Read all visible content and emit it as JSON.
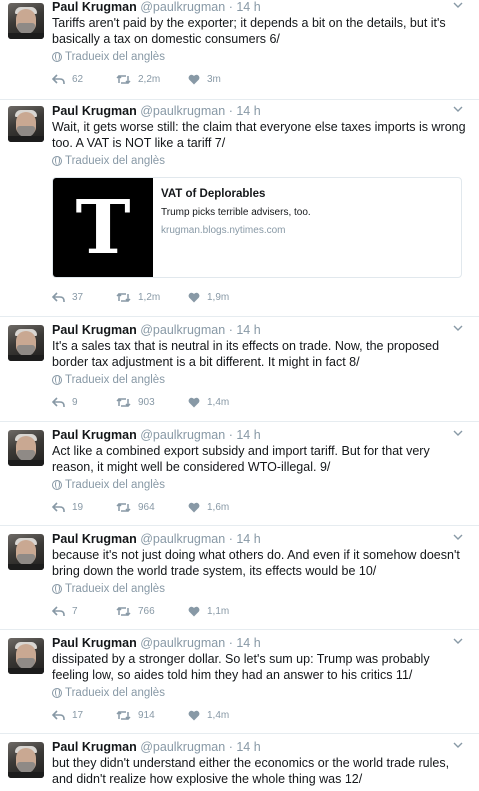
{
  "author": {
    "name": "Paul Krugman",
    "handle": "@paulkrugman",
    "dot": "·"
  },
  "translate_label": "Tradueix del anglès",
  "icons": {
    "reply": "reply-icon",
    "retweet": "retweet-icon",
    "like": "heart-icon",
    "caret": "chevron-down-icon",
    "globe": "globe-icon"
  },
  "colors": {
    "muted": "#8899a6",
    "text": "#14171a",
    "border": "#e6ecf0"
  },
  "tweets": [
    {
      "time": "14 h",
      "text": "Tariffs aren't paid by the exporter; it depends a bit on the details, but it's basically a tax on domestic consumers 6/",
      "replies": "62",
      "retweets": "2,2m",
      "likes": "3m"
    },
    {
      "time": "14 h",
      "text": "Wait, it gets worse still: the claim that everyone else taxes imports is wrong too. A VAT is NOT like a tariff 7/",
      "replies": "37",
      "retweets": "1,2m",
      "likes": "1,9m",
      "card": {
        "logo": "T",
        "title": "VAT of Deplorables",
        "description": "Trump picks terrible advisers, too.",
        "domain": "krugman.blogs.nytimes.com"
      }
    },
    {
      "time": "14 h",
      "text": "It's a sales tax that is neutral in its effects on trade. Now, the proposed border tax adjustment is a bit different. It might in fact 8/",
      "replies": "9",
      "retweets": "903",
      "likes": "1,4m"
    },
    {
      "time": "14 h",
      "text": "Act like a combined export subsidy and import tariff. But for that very reason, it might well be considered WTO-illegal. 9/",
      "replies": "19",
      "retweets": "964",
      "likes": "1,6m"
    },
    {
      "time": "14 h",
      "text": "because it's not just doing what others do. And even if it somehow doesn't bring down the world trade system, its effects would be 10/",
      "replies": "7",
      "retweets": "766",
      "likes": "1,1m"
    },
    {
      "time": "14 h",
      "text": "dissipated by a stronger dollar. So let's sum up: Trump was probably feeling low, so aides told him they had an answer to his critics 11/",
      "replies": "17",
      "retweets": "914",
      "likes": "1,4m"
    },
    {
      "time": "14 h",
      "text": "but they didn't understand either the economics or the world trade rules, and didn't realize how explosive the whole thing was 12/"
    }
  ]
}
